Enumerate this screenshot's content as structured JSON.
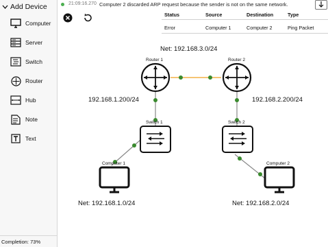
{
  "sidebar": {
    "title": "Add Device",
    "items": [
      {
        "label": "Computer",
        "icon": "computer-icon"
      },
      {
        "label": "Server",
        "icon": "server-icon"
      },
      {
        "label": "Switch",
        "icon": "switch-icon"
      },
      {
        "label": "Router",
        "icon": "router-icon"
      },
      {
        "label": "Hub",
        "icon": "hub-icon"
      },
      {
        "label": "Note",
        "icon": "note-icon"
      },
      {
        "label": "Text",
        "icon": "text-icon"
      }
    ],
    "completion": "Completion: 73%"
  },
  "log": {
    "time": "21:09:16.270",
    "message": "Computer 2 discarded ARP request because the sender is not on the same network."
  },
  "packet_table": {
    "headers": {
      "status": "Status",
      "source": "Source",
      "destination": "Destination",
      "type": "Type"
    },
    "row": {
      "status": "Error",
      "source": "Computer 1",
      "destination": "Computer 2",
      "type": "Ping Packet"
    }
  },
  "network": {
    "net_top": "Net: 192.168.3.0/24",
    "net_left": "Net: 192.168.1.0/24",
    "net_right": "Net: 192.168.2.0/24",
    "ip_left": "192.168.1.200/24",
    "ip_right": "192.168.2.200/24",
    "router1": "Router 1",
    "router2": "Router 2",
    "switch1": "Switch 1",
    "switch2": "Switch 2",
    "computer1": "Computer 1",
    "computer2": "Computer 2"
  },
  "colors": {
    "link_active": "#f0a020",
    "link": "#888888",
    "port": "#3a8a2e",
    "log_dot": "#4caf50"
  }
}
